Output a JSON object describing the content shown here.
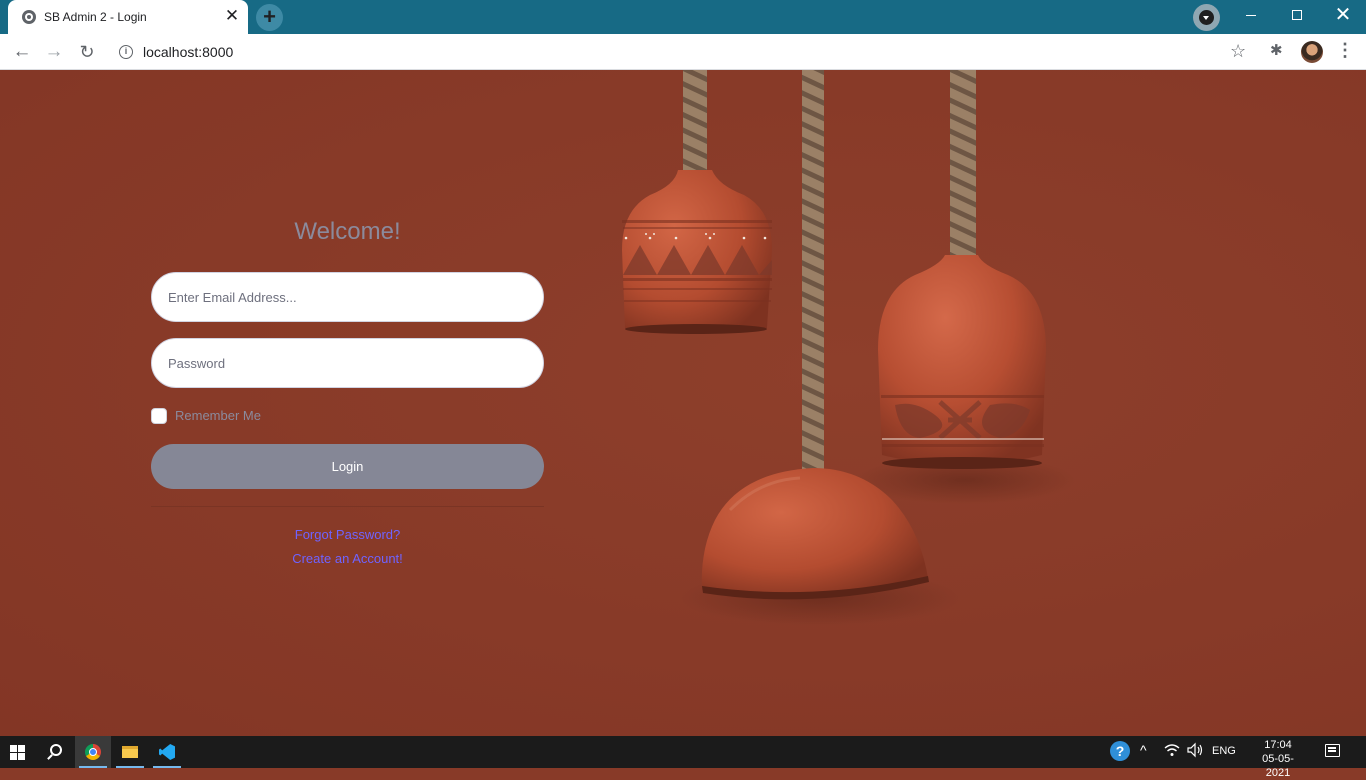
{
  "browser": {
    "tab_title": "SB Admin 2 - Login",
    "tab_close": "✕",
    "new_tab": "+",
    "url": "localhost:8000"
  },
  "icons": {
    "back": "←",
    "forward": "→",
    "reload": "↻",
    "info": "i",
    "star": "☆",
    "extensions": "✱",
    "menu": "⋮",
    "minimize": "minimize-icon",
    "maximize": "maximize-icon",
    "close": "✕"
  },
  "login": {
    "heading": "Welcome!",
    "email_placeholder": "Enter Email Address...",
    "password_placeholder": "Password",
    "remember_label": "Remember Me",
    "login_label": "Login",
    "forgot_link": "Forgot Password?",
    "create_link": "Create an Account!"
  },
  "colors": {
    "page_background": "#883a28",
    "button": "#858796",
    "link": "#6f63ff",
    "tabstrip": "#176a85"
  },
  "taskbar": {
    "help": "?",
    "chevron": "^",
    "wifi": "wifi-icon",
    "volume": "volume-icon",
    "language": "ENG",
    "time": "17:04",
    "date": "05-05-2021"
  }
}
